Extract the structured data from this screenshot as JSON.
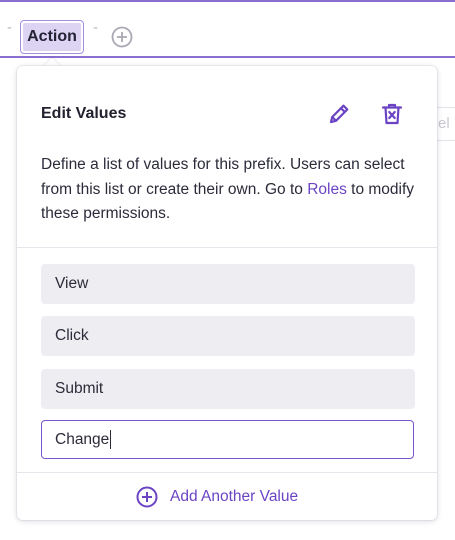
{
  "filter_bar": {
    "left_separator": "-",
    "chip_label": "Action",
    "right_separator": "-",
    "add_icon": "plus-circle-icon",
    "background_label": "el"
  },
  "popover": {
    "title": "Edit Values",
    "edit_icon": "pencil-icon",
    "delete_icon": "trash-icon",
    "description_before_link": "Define a list of values for this prefix. Users can select from this list or create their own. Go to ",
    "description_link": "Roles",
    "description_after_link": " to modify these permissions.",
    "values": [
      "View",
      "Click",
      "Submit"
    ],
    "active_input_value": "Change",
    "add_value_label": "Add Another Value",
    "add_value_icon": "plus-circle-icon"
  },
  "colors": {
    "accent": "#6b44c4",
    "chip_bg": "#ddd3f3",
    "row_bg": "#eeedf1",
    "border_accent": "#8a6fd0"
  }
}
